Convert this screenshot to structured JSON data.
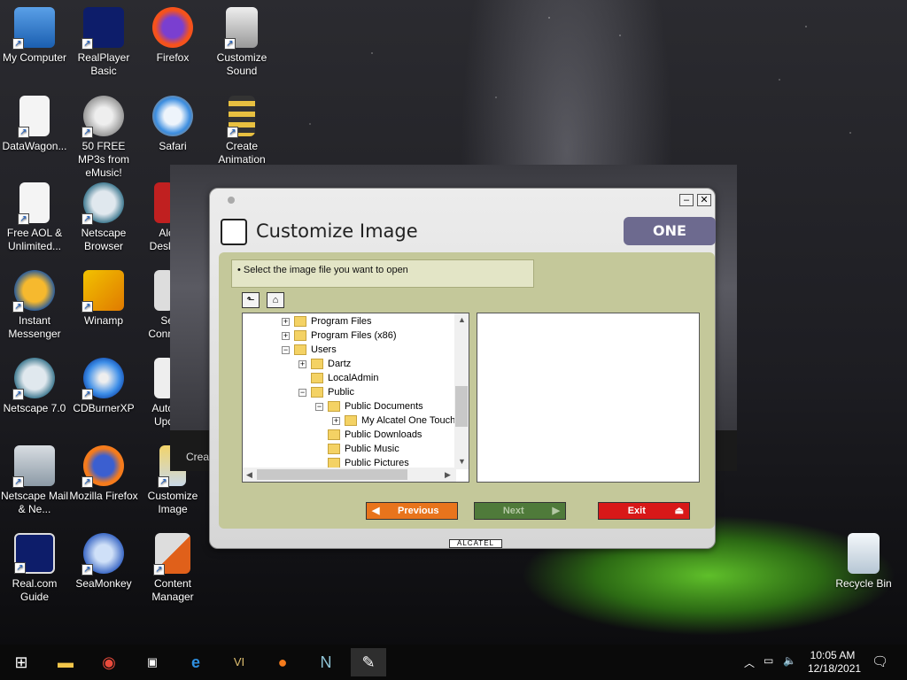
{
  "desktop": {
    "icons": [
      {
        "label": "My Computer"
      },
      {
        "label": "RealPlayer Basic"
      },
      {
        "label": "Firefox"
      },
      {
        "label": "Customize Sound"
      },
      {
        "label": "DataWagon..."
      },
      {
        "label": "50 FREE MP3s from eMusic!"
      },
      {
        "label": "Safari"
      },
      {
        "label": "Create Animation"
      },
      {
        "label": "Free AOL & Unlimited..."
      },
      {
        "label": "Netscape Browser"
      },
      {
        "label": "Alc Desk"
      },
      {
        "label": "Instant Messenger"
      },
      {
        "label": "Winamp"
      },
      {
        "label": "Se Conn"
      },
      {
        "label": "Netscape 7.0"
      },
      {
        "label": "CDBurnerXP"
      },
      {
        "label": "Auto Upd"
      },
      {
        "label": "Netscape Mail & Ne..."
      },
      {
        "label": "Mozilla Firefox"
      },
      {
        "label": "Customize Image"
      },
      {
        "label": "Real.com Guide"
      },
      {
        "label": "SeaMonkey"
      },
      {
        "label": "Content Manager"
      },
      {
        "label": "Recycle Bin"
      }
    ],
    "background_window_label": "Create"
  },
  "dialog": {
    "title": "Customize Image",
    "brand": "ONE TOUCH",
    "hint": "• Select the image file you want to open",
    "tree": [
      {
        "label": "Program Files",
        "expander": "+"
      },
      {
        "label": "Program Files (x86)",
        "expander": "+"
      },
      {
        "label": "Users",
        "expander": "−"
      },
      {
        "label": "Dartz",
        "expander": "+"
      },
      {
        "label": "LocalAdmin",
        "expander": ""
      },
      {
        "label": "Public",
        "expander": "−"
      },
      {
        "label": "Public Documents",
        "expander": "−"
      },
      {
        "label": "My Alcatel One Touch",
        "expander": "+"
      },
      {
        "label": "Public Downloads",
        "expander": ""
      },
      {
        "label": "Public Music",
        "expander": ""
      },
      {
        "label": "Public Pictures",
        "expander": ""
      }
    ],
    "buttons": {
      "previous": "Previous",
      "next": "Next",
      "exit": "Exit"
    },
    "footer_brand": "ALCATEL",
    "colors": {
      "panel": "#c4c89a",
      "brand_bg": "#6d6a8f",
      "previous_btn": "#e8741c",
      "next_btn": "#4f7a3a",
      "exit_btn": "#d81818"
    }
  },
  "taskbar": {
    "items": [
      "start-icon",
      "file-explorer-icon",
      "chrome-icon",
      "terminal-icon",
      "internet-explorer-icon",
      "v1-icon",
      "firefox-icon",
      "netscape-icon",
      "customize-image-icon"
    ],
    "time": "10:05 AM",
    "date": "12/18/2021"
  }
}
